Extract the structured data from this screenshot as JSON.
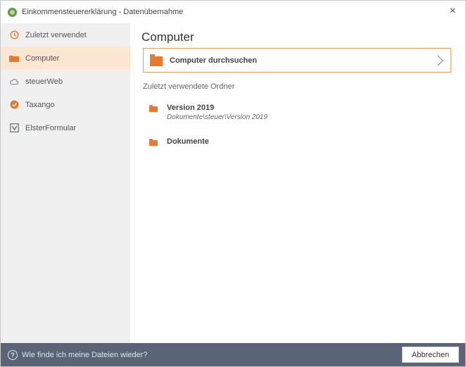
{
  "window": {
    "title": "Einkommensteuererklärung - Datenübernahme",
    "close_glyph": "×"
  },
  "sidebar": {
    "items": [
      {
        "label": "Zuletzt verwendet",
        "icon": "clock-icon",
        "active": false
      },
      {
        "label": "Computer",
        "icon": "folder-icon",
        "active": true
      },
      {
        "label": "steuerWeb",
        "icon": "cloud-icon",
        "active": false
      },
      {
        "label": "Taxango",
        "icon": "taxango-icon",
        "active": false
      },
      {
        "label": "ElsterFormular",
        "icon": "elster-icon",
        "active": false
      }
    ]
  },
  "main": {
    "title": "Computer",
    "browse_label": "Computer durchsuchen",
    "recent_header": "Zuletzt verwendete Ordner",
    "recent_folders": [
      {
        "name": "Version 2019",
        "path": "Dokumente\\steuer\\Version 2019"
      },
      {
        "name": "Dokumente",
        "path": ""
      }
    ]
  },
  "footer": {
    "help_text": "Wie finde ich meine Dateien wieder?",
    "cancel_label": "Abbrechen"
  },
  "colors": {
    "accent": "#e8792f",
    "active_bg": "#fbe6d2",
    "footer_bg": "#5b6376",
    "sidebar_bg": "#f0f0f0"
  }
}
